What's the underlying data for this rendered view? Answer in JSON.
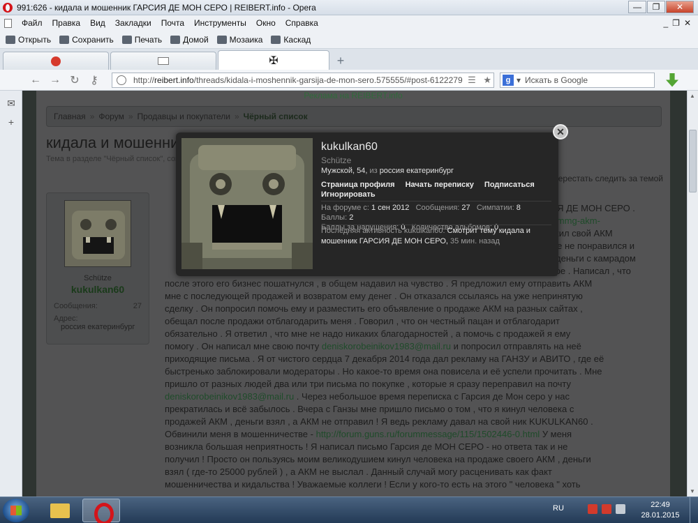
{
  "window": {
    "title": "991:626 - кидала и мошенник ГАРСИЯ ДЕ МОН СЕРО | REIBERT.info - Opera"
  },
  "menu": [
    "Файл",
    "Правка",
    "Вид",
    "Закладки",
    "Почта",
    "Инструменты",
    "Окно",
    "Справка"
  ],
  "toolbar": {
    "open": "Открыть",
    "save": "Сохранить",
    "print": "Печать",
    "home": "Домой",
    "mosaic": "Мозаика",
    "cascade": "Каскад"
  },
  "address": {
    "prefix": "http://",
    "host": "reibert.info",
    "path": "/threads/kidala-i-moshennik-garsija-de-mon-sero.575555/#post-6122279"
  },
  "search": {
    "placeholder": "Искать в Google"
  },
  "page": {
    "ads": "Реклама на REIBERT.info",
    "breadcrumb": [
      "Главная",
      "Форум",
      "Продавцы и покупатели",
      "Чёрный список"
    ],
    "thread_title": "кидала и мошенник ГАРСИЯ ДЕ МОН СЕРО",
    "thread_sub": "Тема в разделе \"Чёрный список\", создана пользователем kukulkan60, 35 мин. назад.",
    "unfollow": "Перестать следить за темой",
    "userbox": {
      "rank": "Schütze",
      "name": "kukulkan60",
      "messages_label": "Сообщения:",
      "messages_value": "27",
      "address_label": "Адрес:",
      "address_value": "россия екатеринбург"
    },
    "post": {
      "p1": "ГАРСИЯ ДЕ МОН СЕРО .",
      "p2": "eads/mmg-akm-",
      "p3": "жил свой АКМ",
      "p4": "мне не понравился и",
      "p5": "деньги с камрадом",
      "p6": "горе . Написал , что",
      "l1": "после этого его бизнес пошатнулся , в общем надавил на чувство . Я предложил ему отправить АКМ",
      "l2": "мне с последующей продажей и возвратом ему денег . Он отказался ссылаясь на уже непринятую",
      "l3": "сделку . Он попросил помочь ему и разместить его объявление о продаже АКМ на разных сайтах ,",
      "l4": "обещал после продажи отблагодарить меня . Говорил , что он честный пацан и отблагодарит",
      "l5": "обязательно . Я ответил , что мне не надо никаких благодарностей , а помочь с продажей я ему",
      "l6a": "помогу . Он написал мне свою почту ",
      "email1": "deniskorobeinikov1983@mail.ru",
      "l6b": " и попросил отправлять на неё",
      "l7": "приходящие письма . Я от чистого сердца 7 декабря 2014 года дал рекламу на ГАНЗУ и АВИТО , где её",
      "l8": "быстренько заблокировали модераторы . Но какое-то время она повисела и её успели прочитать . Мне",
      "l9": "пришло от разных людей два или три письма по покупке , которые я сразу переправил на почту",
      "email2": "deniskorobeinikov1983@mail.ru",
      "l10": " . Через небольшое время переписка с Гарсия де Мон серо у нас",
      "l11": "прекратилась и всё забылось . Вчера с Ганзы мне пришло письмо о том , что я кинул человека с",
      "l12": "продажей АКМ , деньги взял , а АКМ не отправил ! Я ведь рекламу давал на свой ник KUKULKAN60 .",
      "l13a": "Обвинили меня в мошенничестве - ",
      "link1": "http://forum.guns.ru/forummessage/115/1502446-0.html",
      "l13b": " У меня",
      "l14": "возникла большая неприятность ! Я написал письмо Гарсия де МОН СЕРО - но ответа так и не",
      "l15": "получил ! Просто он пользуясь моим великодушием кинул человека на продаже своего АКМ , деньги",
      "l16": "взял ( где-то 25000 рублей ) , а АКМ не выслал . Данный случай могу расценивать как факт",
      "l17": "мошенничества и кидальства ! Уважаемые коллеги ! Если у кого-то есть на этого \" человека \" хоть"
    }
  },
  "popup": {
    "name": "kukulkan60",
    "rank": "Schütze",
    "info_a": "Мужской, 54, ",
    "info_from": "из ",
    "info_loc": "россия екатеринбург",
    "links": [
      "Страница профиля",
      "Начать переписку",
      "Подписаться",
      "Игнорировать"
    ],
    "stats": {
      "joined_label": "На форуме с: ",
      "joined_value": "1 сен 2012",
      "messages_label": "Сообщения: ",
      "messages_value": "27",
      "likes_label": "Симпатии: ",
      "likes_value": "8",
      "points_label": "Баллы: ",
      "points_value": "2",
      "violations_label": "Баллы за нарушения: ",
      "violations_value": "0",
      "albums_label": "Количество альбомов: ",
      "albums_value": "0"
    },
    "activity": {
      "label": "Последняя активность kukulkan60: ",
      "text": "Смотрит тему кидала и мошенник ГАРСИЯ ДЕ МОН СЕРО,",
      "ago": " 35 мин. назад"
    }
  },
  "taskbar": {
    "lang": "RU",
    "time": "22:49",
    "date": "28.01.2015"
  }
}
